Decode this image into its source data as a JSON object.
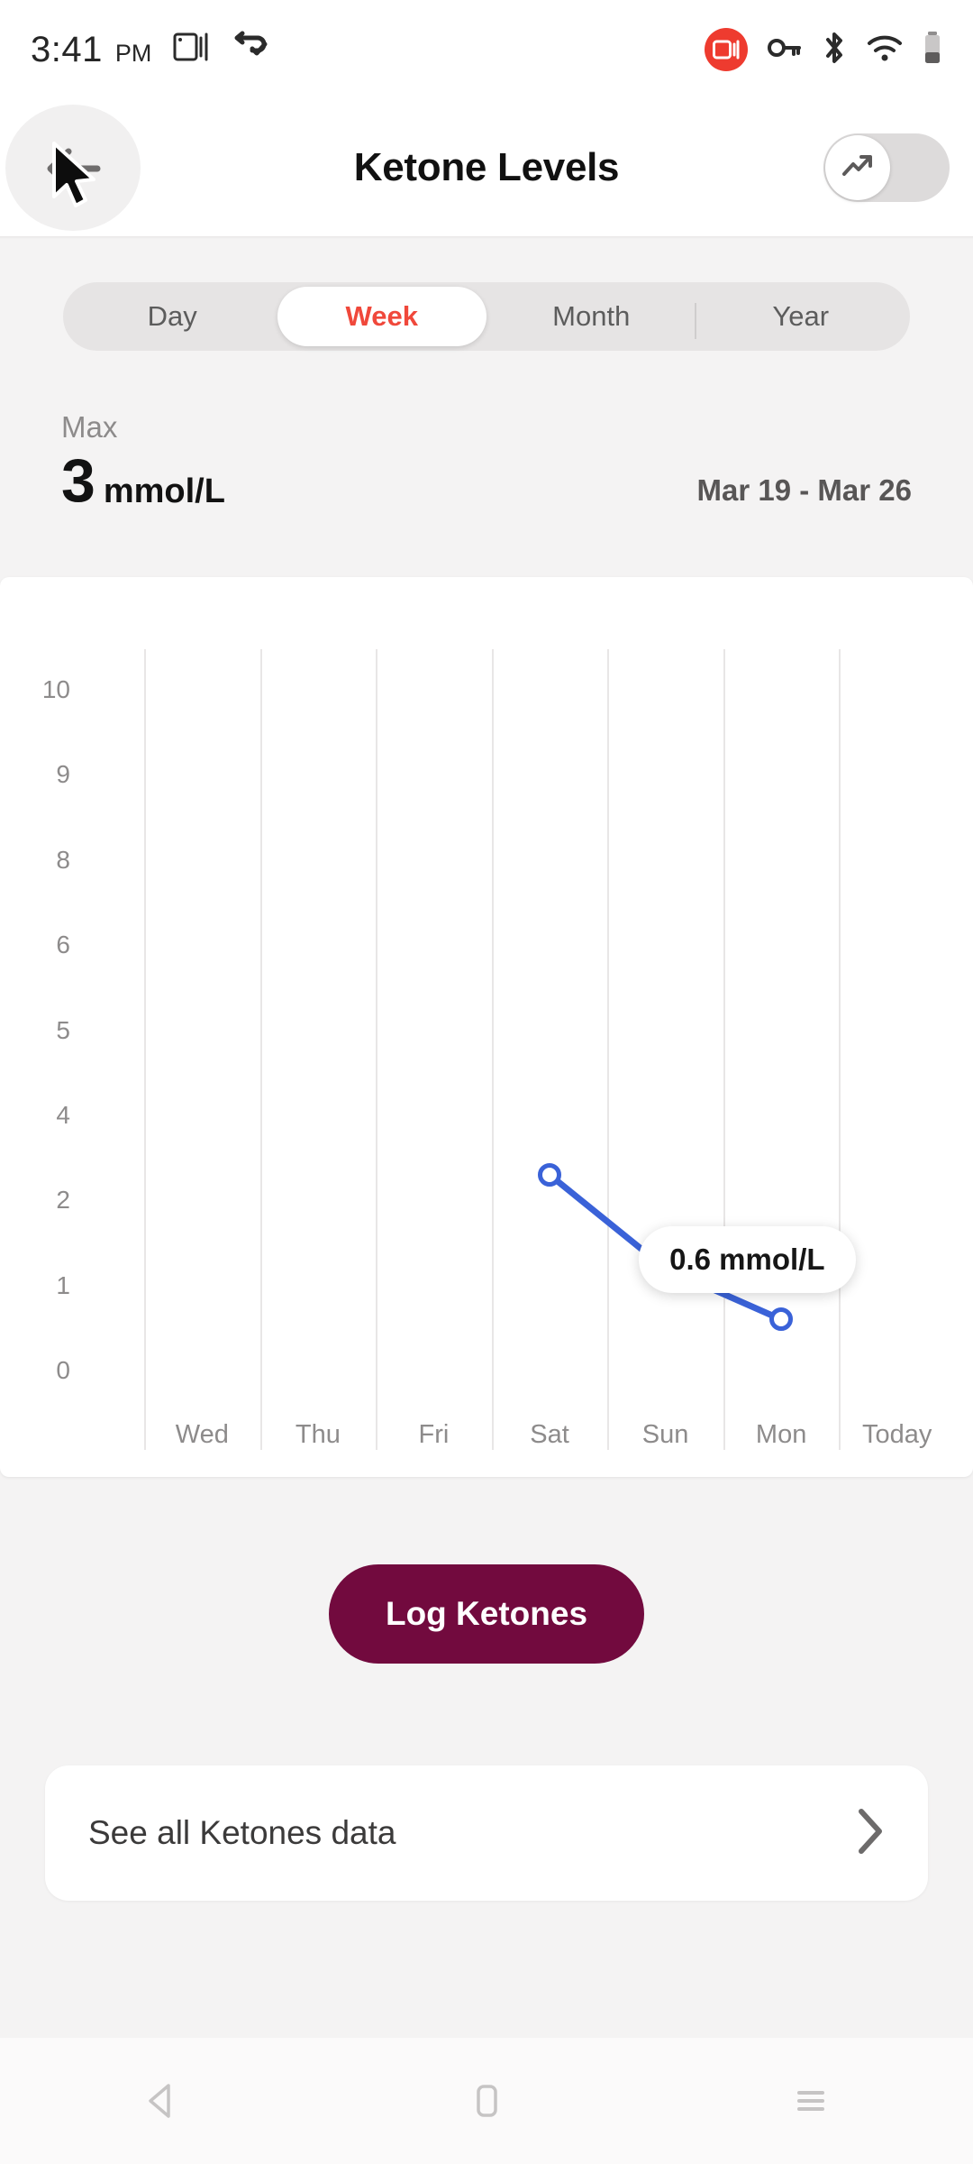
{
  "status_bar": {
    "time": "3:41",
    "ampm": "PM",
    "icons": [
      "screen-cast-icon",
      "vpn-key-sync-icon",
      "screen-record-icon",
      "key-icon",
      "bluetooth-icon",
      "wifi-icon",
      "battery-icon"
    ]
  },
  "header": {
    "title": "Ketone Levels",
    "back_icon": "back-arrow-icon",
    "cursor_icon": "mouse-cursor",
    "toggle_icon": "trending-up-icon",
    "toggle_state": "off"
  },
  "segments": {
    "items": [
      {
        "label": "Day",
        "active": false
      },
      {
        "label": "Week",
        "active": true
      },
      {
        "label": "Month",
        "active": false
      },
      {
        "label": "Year",
        "active": false
      }
    ],
    "active_color": "#f0483b"
  },
  "summary": {
    "stat_label": "Max",
    "value": "3",
    "unit": "mmol/L",
    "date_range": "Mar 19 - Mar 26"
  },
  "chart_data": {
    "type": "line",
    "title": "Ketone Levels",
    "xlabel": "",
    "ylabel": "mmol/L",
    "categories": [
      "Wed",
      "Thu",
      "Fri",
      "Sat",
      "Sun",
      "Mon",
      "Today"
    ],
    "ytick_labels": [
      "10",
      "9",
      "8",
      "6",
      "5",
      "4",
      "2",
      "1",
      "0"
    ],
    "ylim": [
      0,
      10
    ],
    "grid": "vertical",
    "legend": "none",
    "series": [
      {
        "name": "Ketones",
        "color": "#3a62d8",
        "points": [
          {
            "x": "Sat",
            "y": 2.6
          },
          {
            "x": "Sun",
            "y": 1.2
          },
          {
            "x": "Mon",
            "y": 0.6
          }
        ]
      }
    ],
    "annotations": [
      {
        "text": "0.6 mmol/L",
        "attached_to": "Mon"
      }
    ]
  },
  "actions": {
    "log_button": "Log Ketones",
    "see_all_label": "See all Ketones data",
    "chevron_icon": "chevron-right-icon"
  },
  "navbar": {
    "back": "nav-back-icon",
    "home": "nav-home-icon",
    "recents": "nav-recents-icon"
  },
  "colors": {
    "accent_red": "#f0483b",
    "brand_maroon": "#720a3e",
    "line_blue": "#3a62d8",
    "page_bg": "#f4f3f3"
  }
}
